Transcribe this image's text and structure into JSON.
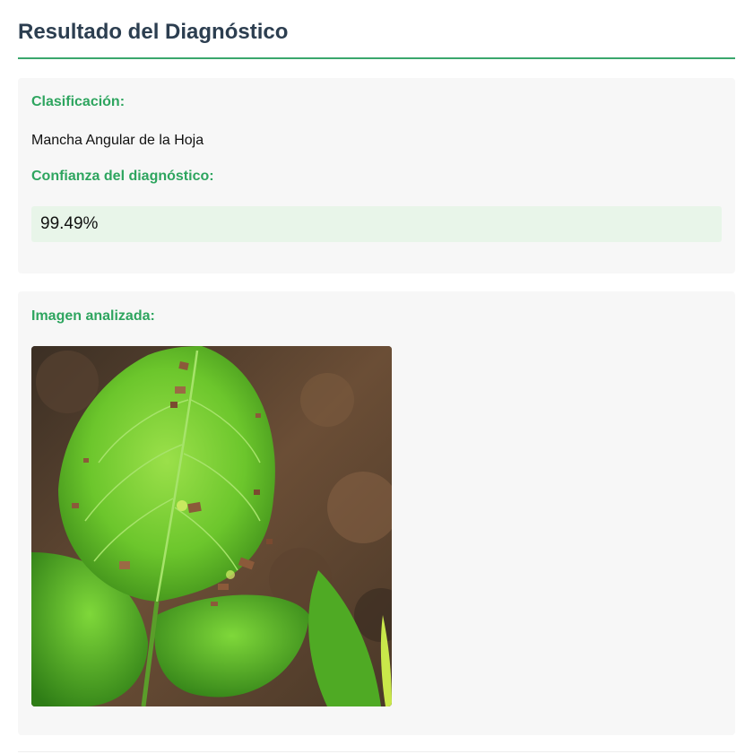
{
  "header": {
    "title": "Resultado del Diagnóstico"
  },
  "result": {
    "classification_label": "Clasificación:",
    "classification_value": "Mancha Angular de la Hoja",
    "confidence_label": "Confianza del diagnóstico:",
    "confidence_value": "99.49%"
  },
  "image_section": {
    "label": "Imagen analizada:",
    "image_alt": "bean-leaf-with-angular-spots"
  },
  "colors": {
    "accent": "#2ea55f",
    "title": "#2c3e50",
    "card_bg": "#f7f7f7",
    "confidence_bg": "#e8f5e9"
  }
}
